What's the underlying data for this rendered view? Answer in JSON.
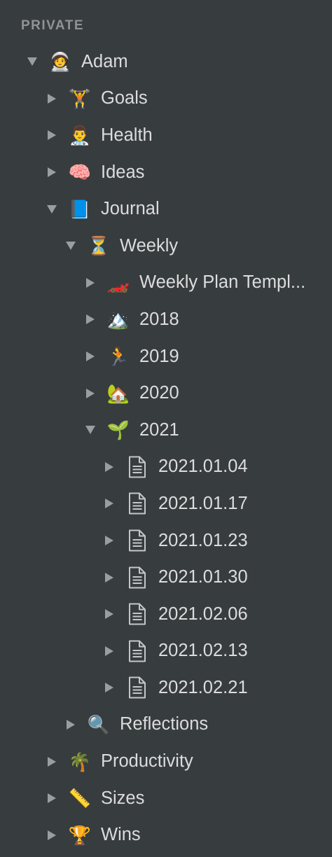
{
  "sidebar": {
    "section_title": "PRIVATE",
    "items": [
      {
        "label": "Adam",
        "icon": "🧑‍🚀",
        "icon_name": "astronaut-icon",
        "expanded": true
      },
      {
        "label": "Goals",
        "icon": "🏋️",
        "icon_name": "weightlifter-icon",
        "expanded": false
      },
      {
        "label": "Health",
        "icon": "👨‍⚕️",
        "icon_name": "doctor-icon",
        "expanded": false
      },
      {
        "label": "Ideas",
        "icon": "🧠",
        "icon_name": "brain-icon",
        "expanded": false
      },
      {
        "label": "Journal",
        "icon": "📘",
        "icon_name": "blue-book-icon",
        "expanded": true
      },
      {
        "label": "Weekly",
        "icon": "⏳",
        "icon_name": "hourglass-icon",
        "expanded": true
      },
      {
        "label": "Weekly Plan Templ...",
        "icon": "🏎️",
        "icon_name": "race-car-icon",
        "expanded": false
      },
      {
        "label": "2018",
        "icon": "🏔️",
        "icon_name": "mountain-icon",
        "expanded": false
      },
      {
        "label": "2019",
        "icon": "🏃",
        "icon_name": "runner-icon",
        "expanded": false
      },
      {
        "label": "2020",
        "icon": "🏡",
        "icon_name": "house-garden-icon",
        "expanded": false
      },
      {
        "label": "2021",
        "icon": "🌱",
        "icon_name": "seedling-icon",
        "expanded": true
      },
      {
        "label": "2021.01.04",
        "icon_name": "document-icon",
        "expanded": false
      },
      {
        "label": "2021.01.17",
        "icon_name": "document-icon",
        "expanded": false
      },
      {
        "label": "2021.01.23",
        "icon_name": "document-icon",
        "expanded": false
      },
      {
        "label": "2021.01.30",
        "icon_name": "document-icon",
        "expanded": false
      },
      {
        "label": "2021.02.06",
        "icon_name": "document-icon",
        "expanded": false
      },
      {
        "label": "2021.02.13",
        "icon_name": "document-icon",
        "expanded": false
      },
      {
        "label": "2021.02.21",
        "icon_name": "document-icon",
        "expanded": false
      },
      {
        "label": "Reflections",
        "icon": "🔍",
        "icon_name": "magnifying-glass-icon",
        "expanded": false
      },
      {
        "label": "Productivity",
        "icon": "🌴",
        "icon_name": "palm-tree-icon",
        "expanded": false
      },
      {
        "label": "Sizes",
        "icon": "📏",
        "icon_name": "ruler-icon",
        "expanded": false
      },
      {
        "label": "Wins",
        "icon": "🏆",
        "icon_name": "trophy-icon",
        "expanded": false
      }
    ]
  },
  "colors": {
    "background": "#373c3f",
    "text": "#dcdcdc",
    "section_header": "#8f9396",
    "chevron": "#9a9ea1"
  }
}
